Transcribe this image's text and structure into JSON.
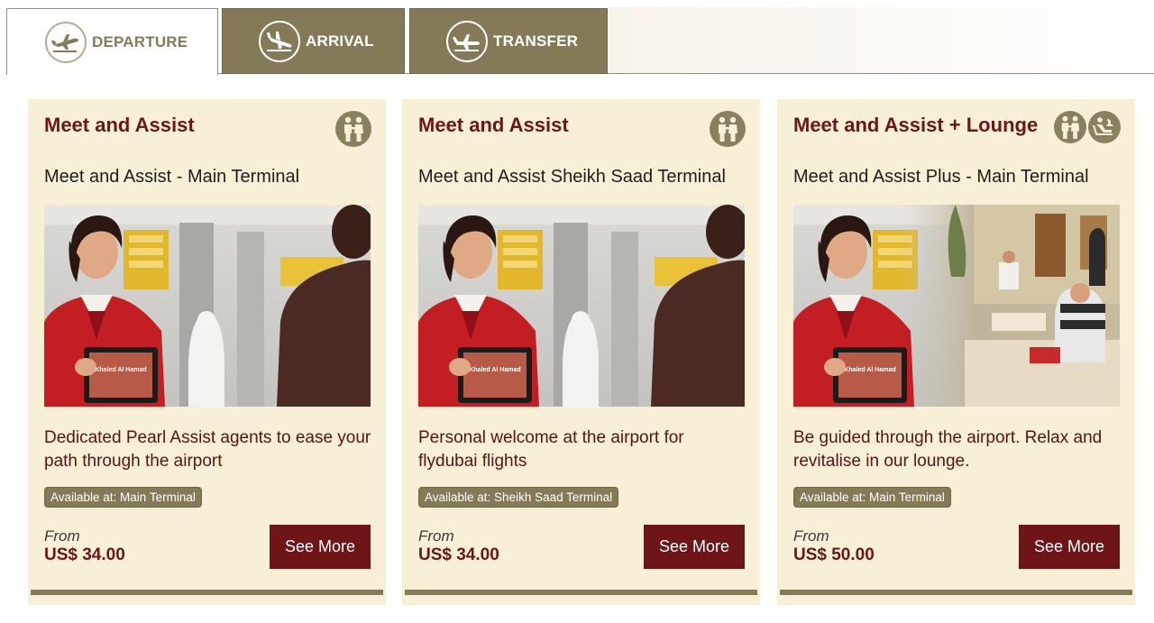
{
  "tabs": [
    {
      "label": "DEPARTURE",
      "icon": "plane-departure-icon",
      "active": true
    },
    {
      "label": "ARRIVAL",
      "icon": "plane-arrival-icon",
      "active": false
    },
    {
      "label": "TRANSFER",
      "icon": "plane-transfer-icon",
      "active": false
    }
  ],
  "colors": {
    "accent_olive": "#857a58",
    "card_bg": "#f7f0d7",
    "title_maroon": "#6b1618",
    "button_maroon": "#6e1517"
  },
  "cards": [
    {
      "title": "Meet and Assist",
      "subtitle": "Meet and Assist - Main Terminal",
      "icons": [
        "meet-assist-icon"
      ],
      "description": "Dedicated Pearl Assist agents to ease your path through the airport",
      "available": "Available at: Main Terminal",
      "from_label": "From",
      "price": "US$ 34.00",
      "button": "See More",
      "photo_tablet_text": "Khaled Al Hamad"
    },
    {
      "title": "Meet and Assist",
      "subtitle": "Meet and Assist Sheikh Saad Terminal",
      "icons": [
        "meet-assist-icon"
      ],
      "description": "Personal welcome at the airport for flydubai flights",
      "available": "Available at: Sheikh Saad Terminal",
      "from_label": "From",
      "price": "US$ 34.00",
      "button": "See More",
      "photo_tablet_text": "Khaled Al Hamad"
    },
    {
      "title": "Meet and Assist + Lounge",
      "subtitle": "Meet and Assist Plus - Main Terminal",
      "icons": [
        "meet-assist-icon",
        "lounge-icon"
      ],
      "description": "Be guided through the airport. Relax and revitalise in our lounge.",
      "available": "Available at: Main Terminal",
      "from_label": "From",
      "price": "US$ 50.00",
      "button": "See More",
      "photo_tablet_text": "Khaled Al Hamad"
    }
  ]
}
